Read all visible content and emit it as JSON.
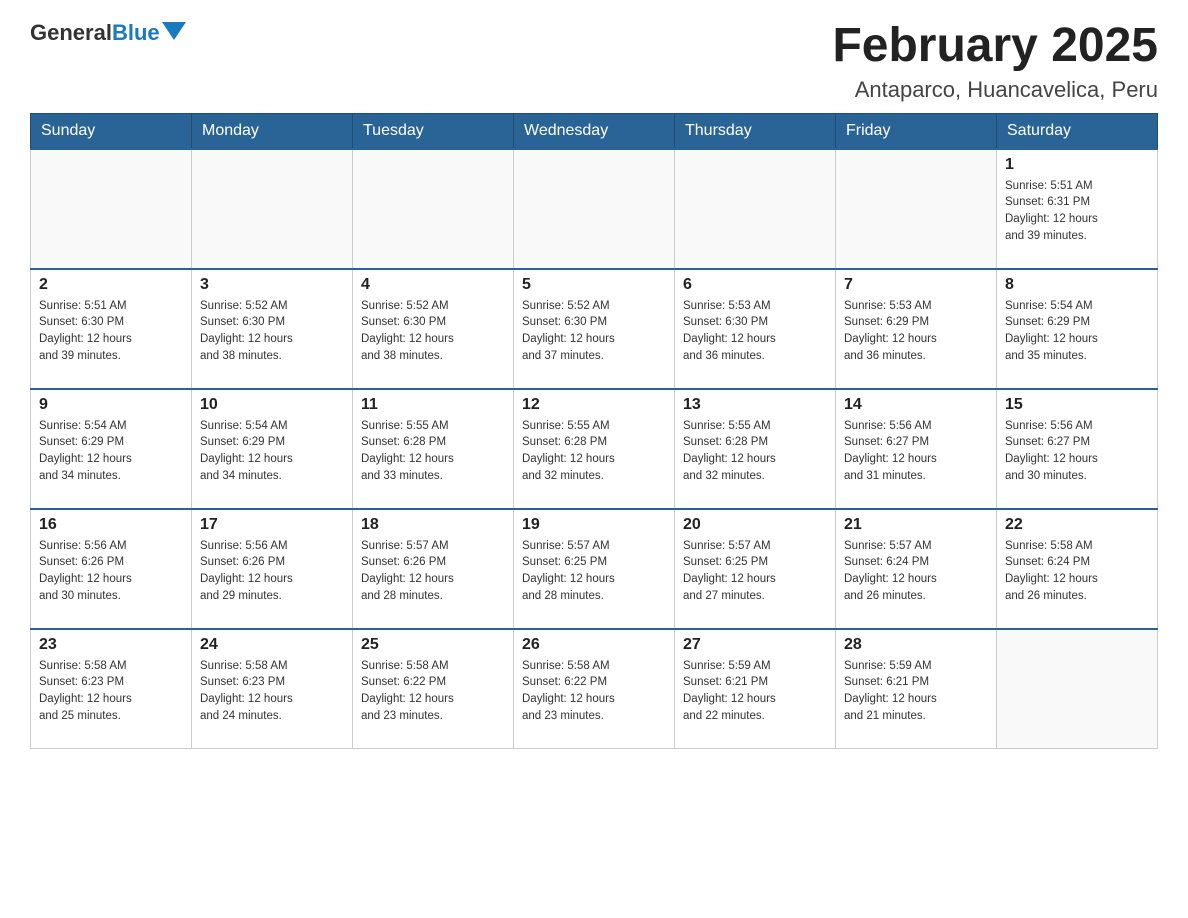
{
  "logo": {
    "text_general": "General",
    "text_blue": "Blue"
  },
  "title": "February 2025",
  "subtitle": "Antaparco, Huancavelica, Peru",
  "days_of_week": [
    "Sunday",
    "Monday",
    "Tuesday",
    "Wednesday",
    "Thursday",
    "Friday",
    "Saturday"
  ],
  "weeks": [
    [
      {
        "day": "",
        "info": ""
      },
      {
        "day": "",
        "info": ""
      },
      {
        "day": "",
        "info": ""
      },
      {
        "day": "",
        "info": ""
      },
      {
        "day": "",
        "info": ""
      },
      {
        "day": "",
        "info": ""
      },
      {
        "day": "1",
        "info": "Sunrise: 5:51 AM\nSunset: 6:31 PM\nDaylight: 12 hours\nand 39 minutes."
      }
    ],
    [
      {
        "day": "2",
        "info": "Sunrise: 5:51 AM\nSunset: 6:30 PM\nDaylight: 12 hours\nand 39 minutes."
      },
      {
        "day": "3",
        "info": "Sunrise: 5:52 AM\nSunset: 6:30 PM\nDaylight: 12 hours\nand 38 minutes."
      },
      {
        "day": "4",
        "info": "Sunrise: 5:52 AM\nSunset: 6:30 PM\nDaylight: 12 hours\nand 38 minutes."
      },
      {
        "day": "5",
        "info": "Sunrise: 5:52 AM\nSunset: 6:30 PM\nDaylight: 12 hours\nand 37 minutes."
      },
      {
        "day": "6",
        "info": "Sunrise: 5:53 AM\nSunset: 6:30 PM\nDaylight: 12 hours\nand 36 minutes."
      },
      {
        "day": "7",
        "info": "Sunrise: 5:53 AM\nSunset: 6:29 PM\nDaylight: 12 hours\nand 36 minutes."
      },
      {
        "day": "8",
        "info": "Sunrise: 5:54 AM\nSunset: 6:29 PM\nDaylight: 12 hours\nand 35 minutes."
      }
    ],
    [
      {
        "day": "9",
        "info": "Sunrise: 5:54 AM\nSunset: 6:29 PM\nDaylight: 12 hours\nand 34 minutes."
      },
      {
        "day": "10",
        "info": "Sunrise: 5:54 AM\nSunset: 6:29 PM\nDaylight: 12 hours\nand 34 minutes."
      },
      {
        "day": "11",
        "info": "Sunrise: 5:55 AM\nSunset: 6:28 PM\nDaylight: 12 hours\nand 33 minutes."
      },
      {
        "day": "12",
        "info": "Sunrise: 5:55 AM\nSunset: 6:28 PM\nDaylight: 12 hours\nand 32 minutes."
      },
      {
        "day": "13",
        "info": "Sunrise: 5:55 AM\nSunset: 6:28 PM\nDaylight: 12 hours\nand 32 minutes."
      },
      {
        "day": "14",
        "info": "Sunrise: 5:56 AM\nSunset: 6:27 PM\nDaylight: 12 hours\nand 31 minutes."
      },
      {
        "day": "15",
        "info": "Sunrise: 5:56 AM\nSunset: 6:27 PM\nDaylight: 12 hours\nand 30 minutes."
      }
    ],
    [
      {
        "day": "16",
        "info": "Sunrise: 5:56 AM\nSunset: 6:26 PM\nDaylight: 12 hours\nand 30 minutes."
      },
      {
        "day": "17",
        "info": "Sunrise: 5:56 AM\nSunset: 6:26 PM\nDaylight: 12 hours\nand 29 minutes."
      },
      {
        "day": "18",
        "info": "Sunrise: 5:57 AM\nSunset: 6:26 PM\nDaylight: 12 hours\nand 28 minutes."
      },
      {
        "day": "19",
        "info": "Sunrise: 5:57 AM\nSunset: 6:25 PM\nDaylight: 12 hours\nand 28 minutes."
      },
      {
        "day": "20",
        "info": "Sunrise: 5:57 AM\nSunset: 6:25 PM\nDaylight: 12 hours\nand 27 minutes."
      },
      {
        "day": "21",
        "info": "Sunrise: 5:57 AM\nSunset: 6:24 PM\nDaylight: 12 hours\nand 26 minutes."
      },
      {
        "day": "22",
        "info": "Sunrise: 5:58 AM\nSunset: 6:24 PM\nDaylight: 12 hours\nand 26 minutes."
      }
    ],
    [
      {
        "day": "23",
        "info": "Sunrise: 5:58 AM\nSunset: 6:23 PM\nDaylight: 12 hours\nand 25 minutes."
      },
      {
        "day": "24",
        "info": "Sunrise: 5:58 AM\nSunset: 6:23 PM\nDaylight: 12 hours\nand 24 minutes."
      },
      {
        "day": "25",
        "info": "Sunrise: 5:58 AM\nSunset: 6:22 PM\nDaylight: 12 hours\nand 23 minutes."
      },
      {
        "day": "26",
        "info": "Sunrise: 5:58 AM\nSunset: 6:22 PM\nDaylight: 12 hours\nand 23 minutes."
      },
      {
        "day": "27",
        "info": "Sunrise: 5:59 AM\nSunset: 6:21 PM\nDaylight: 12 hours\nand 22 minutes."
      },
      {
        "day": "28",
        "info": "Sunrise: 5:59 AM\nSunset: 6:21 PM\nDaylight: 12 hours\nand 21 minutes."
      },
      {
        "day": "",
        "info": ""
      }
    ]
  ]
}
